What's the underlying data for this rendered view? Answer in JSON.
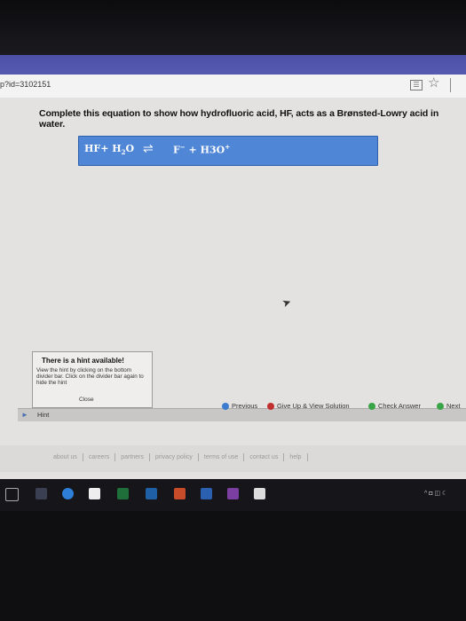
{
  "browser": {
    "url_fragment": "p?id=3102151",
    "reader_icon": "reader-view-icon",
    "star_icon": "bookmark-star-icon"
  },
  "question": {
    "prompt": "Complete this equation to show how hydrofluoric acid, HF, acts as a Brønsted-Lowry acid in water.",
    "left_side": "HF+ H",
    "water_subscript": "2",
    "left_o": "O",
    "arrow": "⇌",
    "f": "F",
    "f_sup": "−",
    "h3o": " + H3O",
    "h3o_sup": "+"
  },
  "hint": {
    "title": "There is a hint available!",
    "text": "View the hint by clicking on the bottom divider bar. Click on the divider bar again to hide the hint",
    "close": "Close",
    "bar_label": "Hint"
  },
  "nav": {
    "previous": "Previous",
    "give_up": "Give Up & View Solution",
    "check": "Check Answer",
    "next": "Next"
  },
  "footer": {
    "links": [
      "about us",
      "careers",
      "partners",
      "privacy policy",
      "terms of use",
      "contact us",
      "help"
    ]
  },
  "taskbar": {
    "tray_text": "^ ◘ ◫ ☾"
  },
  "colors": {
    "answer_box": "#4f86d6",
    "previous_dot": "#3c7bd0",
    "giveup_dot": "#c0302f",
    "check_dot": "#3aa449"
  }
}
